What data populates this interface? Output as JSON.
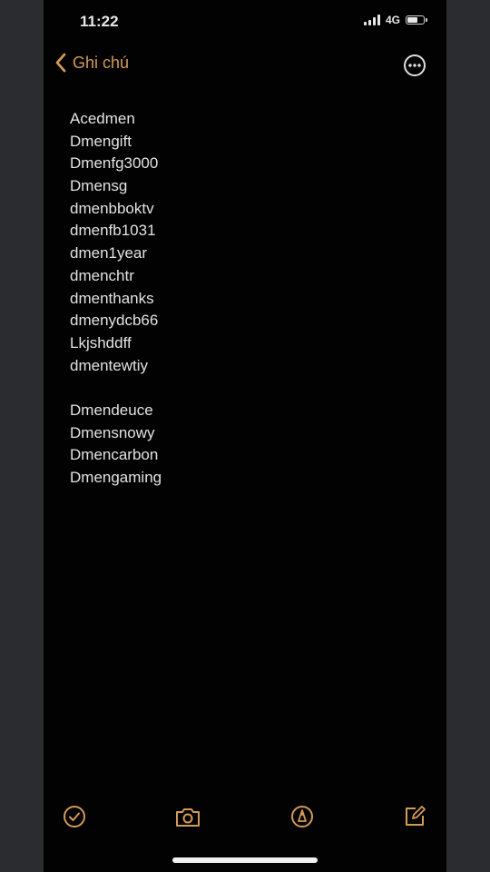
{
  "status_bar": {
    "time": "11:22",
    "network": "4G",
    "icons": [
      "signal-icon",
      "battery-icon"
    ]
  },
  "nav": {
    "back_label": "Ghi chú",
    "icons": [
      "chevron-left-icon",
      "more-ellipsis-icon"
    ]
  },
  "note": {
    "group1": [
      "Acedmen",
      "Dmengift",
      "Dmenfg3000",
      "Dmensg",
      "dmenbboktv",
      "dmenfb1031",
      "dmen1year",
      "dmenchtr",
      "dmenthanks",
      "dmenydcb66",
      "Lkjshddff",
      "dmentewtiy"
    ],
    "group2": [
      "Dmendeuce",
      "Dmensnowy",
      "Dmencarbon",
      "Dmengaming"
    ]
  },
  "toolbar": {
    "icons": [
      "checklist-icon",
      "camera-icon",
      "markup-pen-icon",
      "compose-icon"
    ]
  },
  "colors": {
    "accent": "#d49a56",
    "background": "#020202",
    "text": "#e2e2e2"
  }
}
